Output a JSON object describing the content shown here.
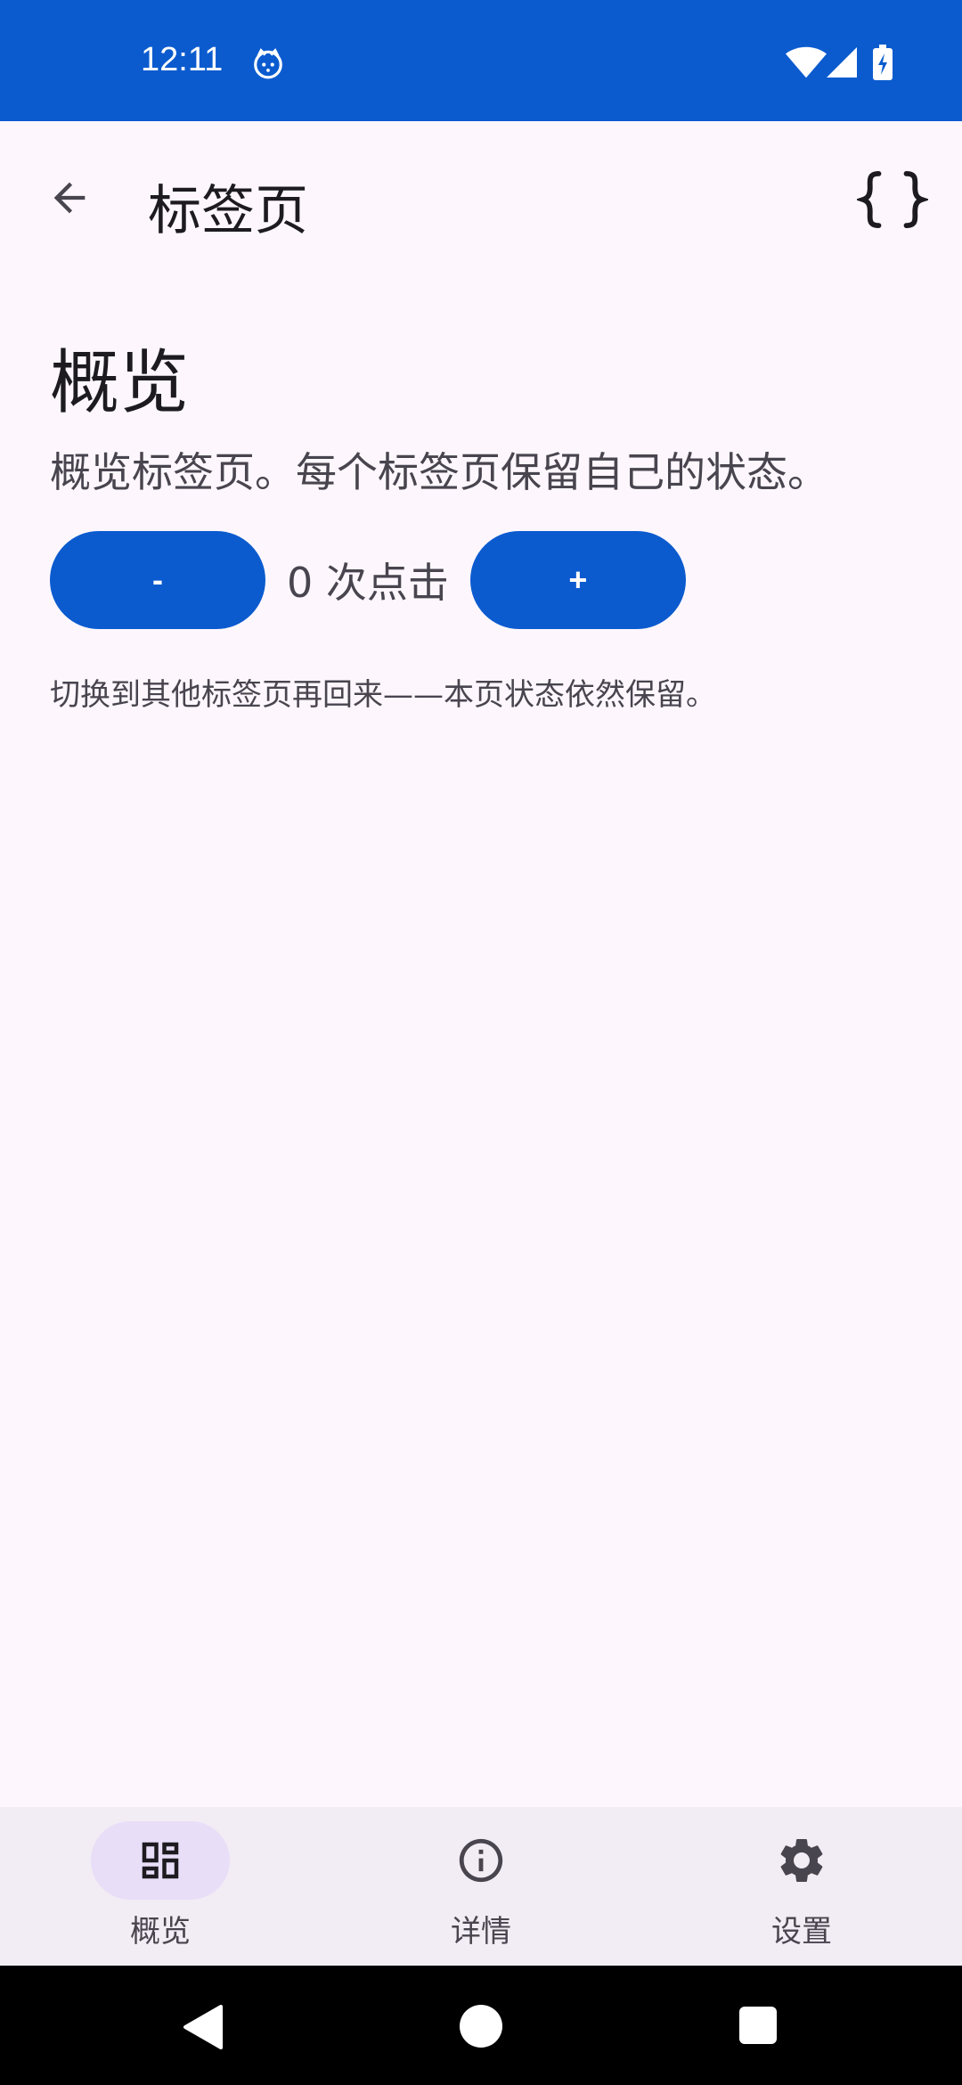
{
  "status_bar": {
    "time": "12:11",
    "background": "#0b5bcf",
    "icons": [
      "cat-notification-icon",
      "wifi-icon",
      "signal-icon",
      "battery-charging-icon"
    ]
  },
  "top_bar": {
    "back_icon": "arrow-back-icon",
    "title": "标签页",
    "action_icon": "curly-braces-icon"
  },
  "content": {
    "heading": "概览",
    "description": "概览标签页。每个标签页保留自己的状态。",
    "decrement_label": "-",
    "counter_text": "0 次点击",
    "increment_label": "+",
    "hint": "切换到其他标签页再回来——本页状态依然保留。"
  },
  "bottom_nav": {
    "items": [
      {
        "label": "概览",
        "icon": "dashboard-icon",
        "active": true
      },
      {
        "label": "详情",
        "icon": "info-icon",
        "active": false
      },
      {
        "label": "设置",
        "icon": "settings-gear-icon",
        "active": false
      }
    ]
  },
  "colors": {
    "accent": "#0b5bcf",
    "background": "#fdf7fd",
    "nav_background": "#f2ecf4",
    "active_indicator": "#e8def8"
  }
}
